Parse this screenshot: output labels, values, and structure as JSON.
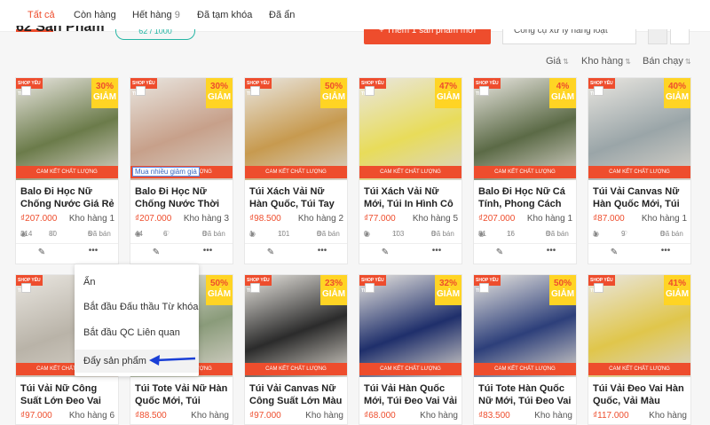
{
  "tabs": [
    {
      "label": "Tất cả"
    },
    {
      "label": "Còn hàng"
    },
    {
      "label": "Hết hàng",
      "count": "9"
    },
    {
      "label": "Đã tạm khóa"
    },
    {
      "label": "Đã ẩn"
    }
  ],
  "header": {
    "product_count": "62 Sản Phẩm",
    "limit_badge": "62 / 1000",
    "add_button": "+ Thêm 1 sản phẩm mới",
    "bulk_select": "Công cụ xử lý hàng loạt"
  },
  "sort": [
    "Giá",
    "Kho hàng",
    "Bán chạy"
  ],
  "card_common": {
    "shop_tag": "SHOP YÊU THÍCH",
    "sale_label": "GIẢM",
    "cam_ket": "CAM KẾT CHẤT LƯỢNG",
    "stock_prefix": "Kho hàng",
    "sold_prefix": "Đã bán"
  },
  "products": [
    {
      "name": "Balo Đi Học Nữ Chống Nước Giá Rẻ Thờ...",
      "price": "₫207.000",
      "stock": "1",
      "views": "214",
      "likes": "80",
      "sold": "6",
      "discount": "30%",
      "promo": "",
      "img": "#6b7b4a"
    },
    {
      "name": "Balo Đi Học Nữ Chống Nước Thời Trang ...",
      "price": "₫207.000",
      "stock": "3",
      "views": "44",
      "likes": "6",
      "sold": "0",
      "discount": "30%",
      "promo": "Mua nhiều giảm giá",
      "img": "#c7a08a"
    },
    {
      "name": "Túi Xách Vải Nữ Hàn Quốc, Túi Tay Dung...",
      "price": "₫98.500",
      "stock": "2",
      "views": "1",
      "likes": "101",
      "sold": "0",
      "discount": "50%",
      "promo": "",
      "img": "#c79a4f"
    },
    {
      "name": "Túi Xách Vải Nữ Mới, Túi In Hình Cô Bé Đ...",
      "price": "₫77.000",
      "stock": "5",
      "views": "0",
      "likes": "103",
      "sold": "0",
      "discount": "47%",
      "promo": "",
      "img": "#e8dc5a"
    },
    {
      "name": "Balo Đi Học Nữ Cá Tính, Phong Cách Hà...",
      "price": "₫207.000",
      "stock": "1",
      "views": "81",
      "likes": "16",
      "sold": "0",
      "discount": "4%",
      "promo": "",
      "img": "#5b6a46"
    },
    {
      "name": "Túi Vải Canvas Nữ Hàn Quốc Mới, Túi Th...",
      "price": "₫87.000",
      "stock": "1",
      "views": "1",
      "likes": "9",
      "sold": "0",
      "discount": "40%",
      "promo": "",
      "img": "#9aa5a8"
    },
    {
      "name": "Túi Vải Nữ Công Suất Lớn Đeo Vai Đẹp C...",
      "price": "₫97.000",
      "stock": "6",
      "views": "",
      "likes": "",
      "sold": "",
      "discount": "",
      "promo": "",
      "img": "#b9b3a8"
    },
    {
      "name": "Túi Tote Vải Nữ Hàn Quốc Mới, Túi Thêu...",
      "price": "₫88.500",
      "stock": "",
      "views": "",
      "likes": "",
      "sold": "",
      "discount": "50%",
      "promo": "",
      "img": "#8a9b7a"
    },
    {
      "name": "Túi Vải Canvas Nữ Công Suất Lớn Màu ...",
      "price": "₫97.000",
      "stock": "",
      "views": "",
      "likes": "",
      "sold": "",
      "discount": "23%",
      "promo": "",
      "img": "#2b2b2b"
    },
    {
      "name": "Túi Vải Hàn Quốc Mới, Túi Đeo Vai Vải M...",
      "price": "₫68.000",
      "stock": "",
      "views": "",
      "likes": "",
      "sold": "",
      "discount": "32%",
      "promo": "",
      "img": "#1f2f6b"
    },
    {
      "name": "Túi Tote Hàn Quốc Nữ Mới, Túi Đeo Vai ...",
      "price": "₫83.500",
      "stock": "",
      "views": "",
      "likes": "",
      "sold": "",
      "discount": "50%",
      "promo": "",
      "img": "#2d3f7a"
    },
    {
      "name": "Túi Vải Đeo Vai Hàn Quốc, Vải Màu Tươn...",
      "price": "₫117.000",
      "stock": "",
      "views": "",
      "likes": "",
      "sold": "",
      "discount": "41%",
      "promo": "",
      "img": "#e0c64b"
    }
  ],
  "context_menu": [
    "Ẩn",
    "Bắt đầu Đấu thầu Từ khóa",
    "Bắt đầu QC Liên quan",
    "Đẩy sản phẩm"
  ],
  "colors": {
    "accent": "#ee4d2d",
    "sale_yellow": "#ffd424",
    "arrow_blue": "#1a3fd6"
  }
}
